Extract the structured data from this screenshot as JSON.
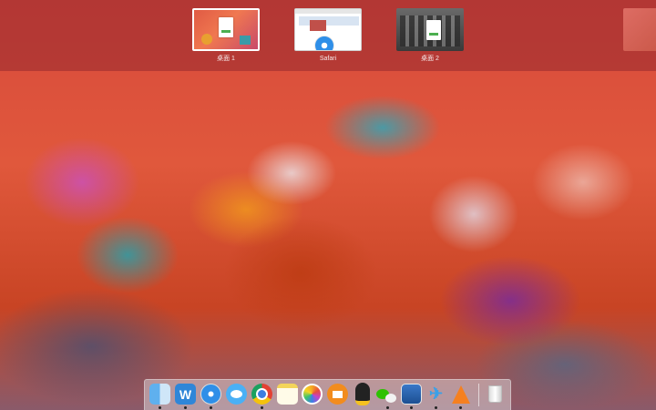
{
  "spaces": [
    {
      "label": "桌面 1",
      "selected": true
    },
    {
      "label": "Safari",
      "selected": false
    },
    {
      "label": "桌面 2",
      "selected": false
    }
  ],
  "dock": {
    "items": [
      {
        "icon": "finder-icon",
        "running": true
      },
      {
        "icon": "wps-writer-icon",
        "running": true
      },
      {
        "icon": "safari-icon",
        "running": true
      },
      {
        "icon": "messages-icon",
        "running": false
      },
      {
        "icon": "chrome-icon",
        "running": true
      },
      {
        "icon": "notes-icon",
        "running": false
      },
      {
        "icon": "photos-icon",
        "running": false
      },
      {
        "icon": "ibooks-icon",
        "running": false
      },
      {
        "icon": "qq-icon",
        "running": false
      },
      {
        "icon": "wechat-icon",
        "running": true
      },
      {
        "icon": "preview-icon",
        "running": true
      },
      {
        "icon": "xcode-tools-icon",
        "running": true
      },
      {
        "icon": "vlc-icon",
        "running": true
      },
      {
        "icon": "trash-icon",
        "running": false
      }
    ]
  }
}
